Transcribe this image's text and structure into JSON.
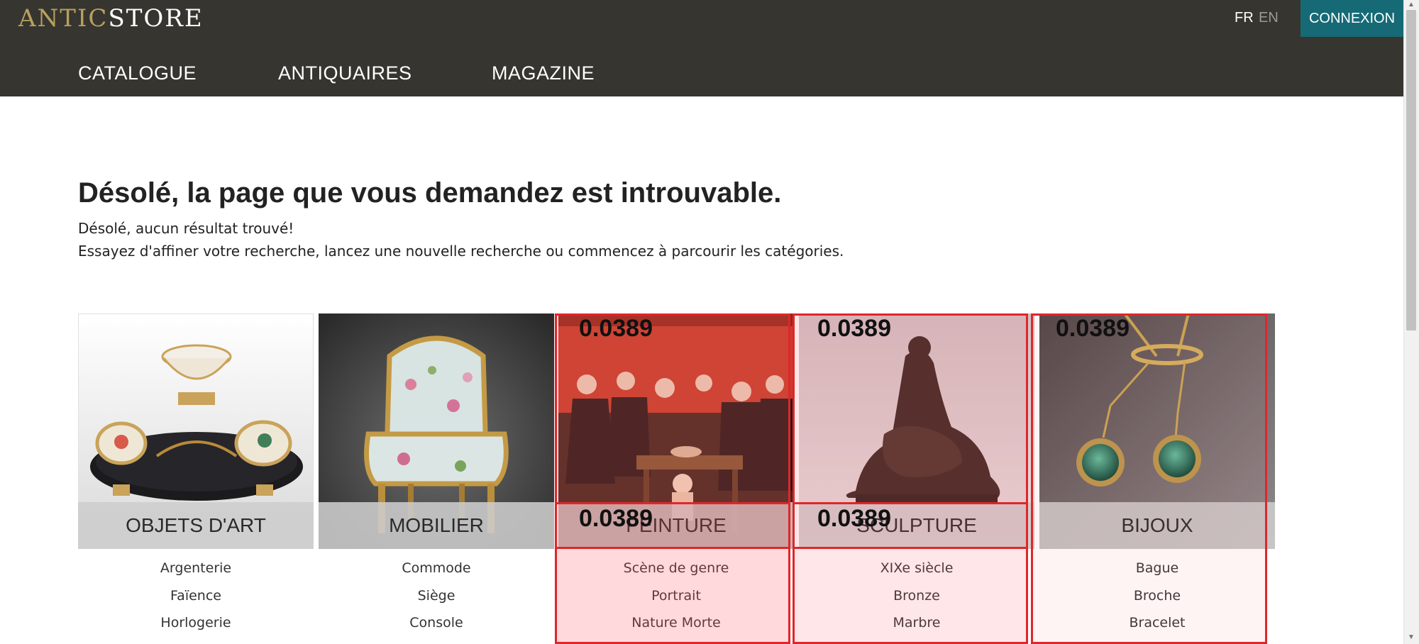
{
  "header": {
    "logo_part1": "ANTIC",
    "logo_part2": "STORE",
    "lang_fr": "FR",
    "lang_en": "EN",
    "login_label": "CONNEXION",
    "nav": [
      "CATALOGUE",
      "ANTIQUAIRES",
      "MAGAZINE"
    ]
  },
  "content": {
    "title": "Désolé, la page que vous demandez est introuvable.",
    "line1": "Désolé, aucun résultat trouvé!",
    "line2": "Essayez d'affiner votre recherche, lancez une nouvelle recherche ou commencez à parcourir les catégories."
  },
  "categories": [
    {
      "label": "OBJETS D'ART",
      "subs": [
        "Argenterie",
        "Faïence",
        "Horlogerie"
      ]
    },
    {
      "label": "MOBILIER",
      "subs": [
        "Commode",
        "Siège",
        "Console"
      ]
    },
    {
      "label": "PEINTURE",
      "subs": [
        "Scène de genre",
        "Portrait",
        "Nature Morte"
      ]
    },
    {
      "label": "SCULPTURE",
      "subs": [
        "XIXe siècle",
        "Bronze",
        "Marbre"
      ]
    },
    {
      "label": "BIJOUX",
      "subs": [
        "Bague",
        "Broche",
        "Bracelet"
      ]
    }
  ],
  "overlays": {
    "scores": [
      "0.0389",
      "0.0389",
      "0.0389",
      "0.0389",
      "0.0389"
    ],
    "color": "#e0262a"
  }
}
